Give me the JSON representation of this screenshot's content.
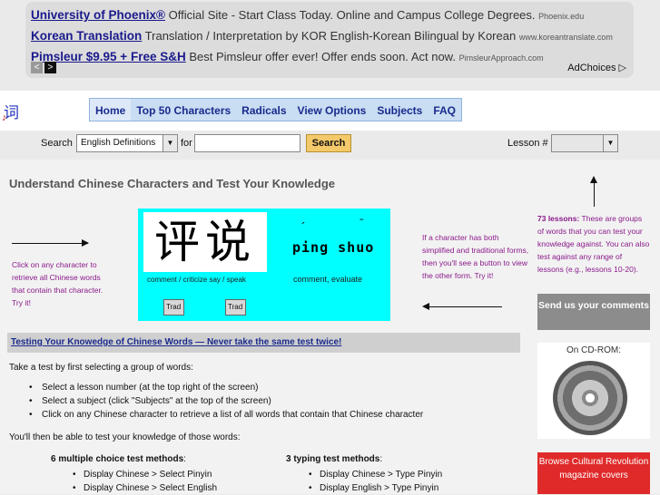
{
  "ad": {
    "items": [
      {
        "title": "University of Phoenix®",
        "desc": "Official Site - Start Class Today. Online and Campus College Degrees.",
        "url": "Phoenix.edu"
      },
      {
        "title": "Korean Translation",
        "desc": "Translation / Interpretation by KOR English-Korean Bilingual by Korean",
        "url": "www.koreantranslate.com"
      },
      {
        "title": "Pimsleur $9.95 + Free S&H",
        "desc": "Best Pimsleur offer ever! Offer ends soon. Act now.",
        "url": "PimsleurApproach.com"
      }
    ],
    "prev_glyph": "<",
    "next_glyph": ">",
    "adchoices": "AdChoices ▷"
  },
  "header": {
    "logo_char": "词",
    "logo_sub": "♪",
    "nav": [
      "Home",
      "Top 50 Characters",
      "Radicals",
      "View Options",
      "Subjects",
      "FAQ"
    ]
  },
  "search": {
    "label": "Search",
    "select_value": "English Definitions",
    "for_label": "for",
    "input_value": "",
    "button": "Search",
    "lesson_label": "Lesson #",
    "lesson_value": ""
  },
  "main": {
    "headline": "Understand Chinese Characters and Test Your Knowledge",
    "left_hint": "Click on any character to retrieve all Chinese words that contain that character. Try it!",
    "right_hint": "If a character has both simplified and traditional forms, then you'll see a button to view the other form. Try it!",
    "demo": {
      "chars": "评说",
      "tone1": "´",
      "tone2": "ˉ",
      "pinyin": "ping shuo",
      "gloss_chars": "comment / criticize say / speak",
      "gloss_word": "comment, evaluate",
      "trad_button_1": "Trad",
      "trad_button_2": "Trad"
    },
    "section_title": "Testing Your Knowedge of Chinese Words — Never take the same test twice!",
    "intro": "Take a test by first selecting a group of words:",
    "steps": [
      "Select a lesson number (at the top right of the screen)",
      "Select a subject (click \"Subjects\" at the top of the screen)",
      "Click on any Chinese character to retrieve a list of all words that contain that Chinese character"
    ],
    "then": "You'll then be able to test your knowledge of those words:",
    "mc_title": "6 multiple choice test methods",
    "mc_items": [
      "Display Chinese > Select Pinyin",
      "Display Chinese > Select English"
    ],
    "typing_title": "3 typing test methods",
    "typing_items": [
      "Display Chinese > Type Pinyin",
      "Display English > Type Pinyin"
    ]
  },
  "sidebar": {
    "lessons_bold": "73 lessons:",
    "lessons_text": "These are groups of words that you can test your knowledge against. You can also test against any range of lessons (e.g., lessons 10-20).",
    "send_comments": "Send us your comments",
    "cdrom_label": "On CD-ROM:",
    "browse": "Browse Cultural Revolution magazine covers"
  }
}
